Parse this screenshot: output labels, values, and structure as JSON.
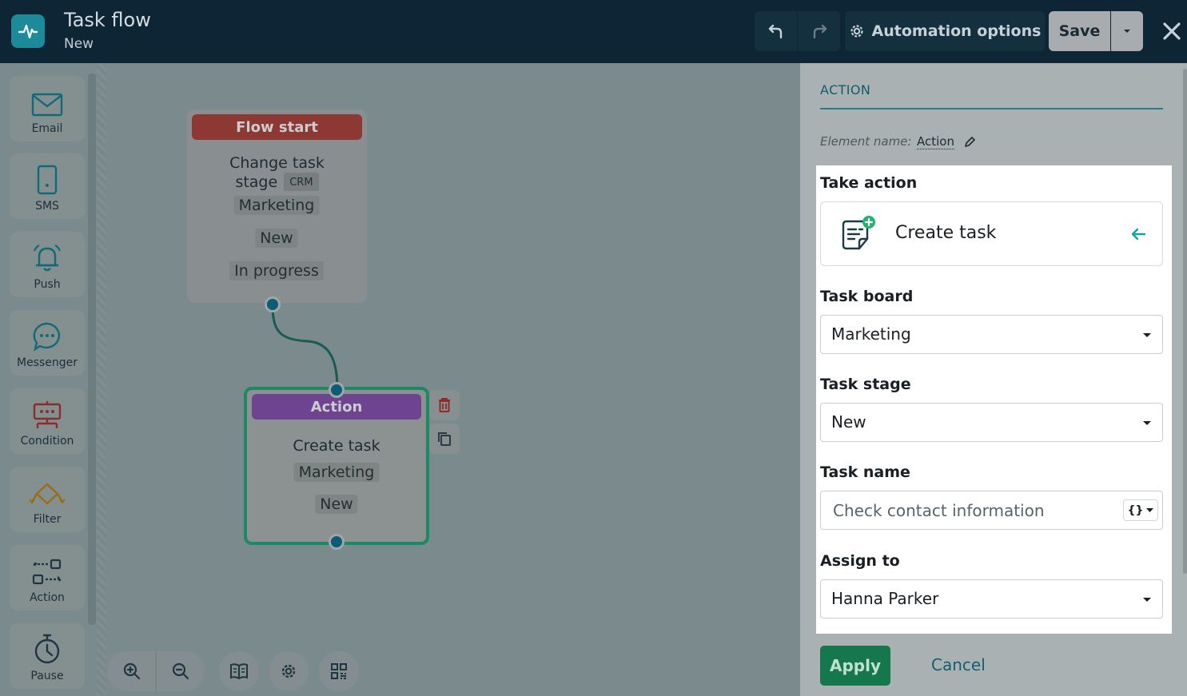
{
  "header": {
    "title": "Task flow",
    "subtitle": "New",
    "automation_label": "Automation options",
    "save_label": "Save"
  },
  "sidebar": {
    "items": [
      {
        "label": "Email",
        "icon": "email-icon"
      },
      {
        "label": "SMS",
        "icon": "phone-icon"
      },
      {
        "label": "Push",
        "icon": "bell-icon"
      },
      {
        "label": "Messenger",
        "icon": "chat-icon"
      },
      {
        "label": "Condition",
        "icon": "condition-icon"
      },
      {
        "label": "Filter",
        "icon": "filter-icon"
      },
      {
        "label": "Action",
        "icon": "action-icon"
      },
      {
        "label": "Pause",
        "icon": "stopwatch-icon"
      }
    ]
  },
  "canvas": {
    "start_node": {
      "title": "Flow start",
      "trigger": "Change task stage",
      "badge": "CRM",
      "board": "Marketing",
      "from_stage": "New",
      "to_stage": "In progress"
    },
    "action_node": {
      "title": "Action",
      "action": "Create task",
      "board": "Marketing",
      "stage": "New"
    }
  },
  "panel": {
    "title": "ACTION",
    "element_name_label": "Element name:",
    "element_name_value": "Action",
    "take_action_label": "Take action",
    "take_action_value": "Create task",
    "task_board_label": "Task board",
    "task_board_value": "Marketing",
    "task_stage_label": "Task stage",
    "task_stage_value": "New",
    "task_name_label": "Task name",
    "task_name_placeholder": "Check contact information",
    "assign_label": "Assign to",
    "assign_value": "Hanna Parker",
    "apply_label": "Apply",
    "cancel_label": "Cancel"
  },
  "colors": {
    "header_bg": "#0d2535",
    "start_header": "#8e3834",
    "action_header": "#6e4390",
    "selected_border": "#1b8a64",
    "apply_button": "#16774e",
    "accent": "#12a3a8"
  }
}
